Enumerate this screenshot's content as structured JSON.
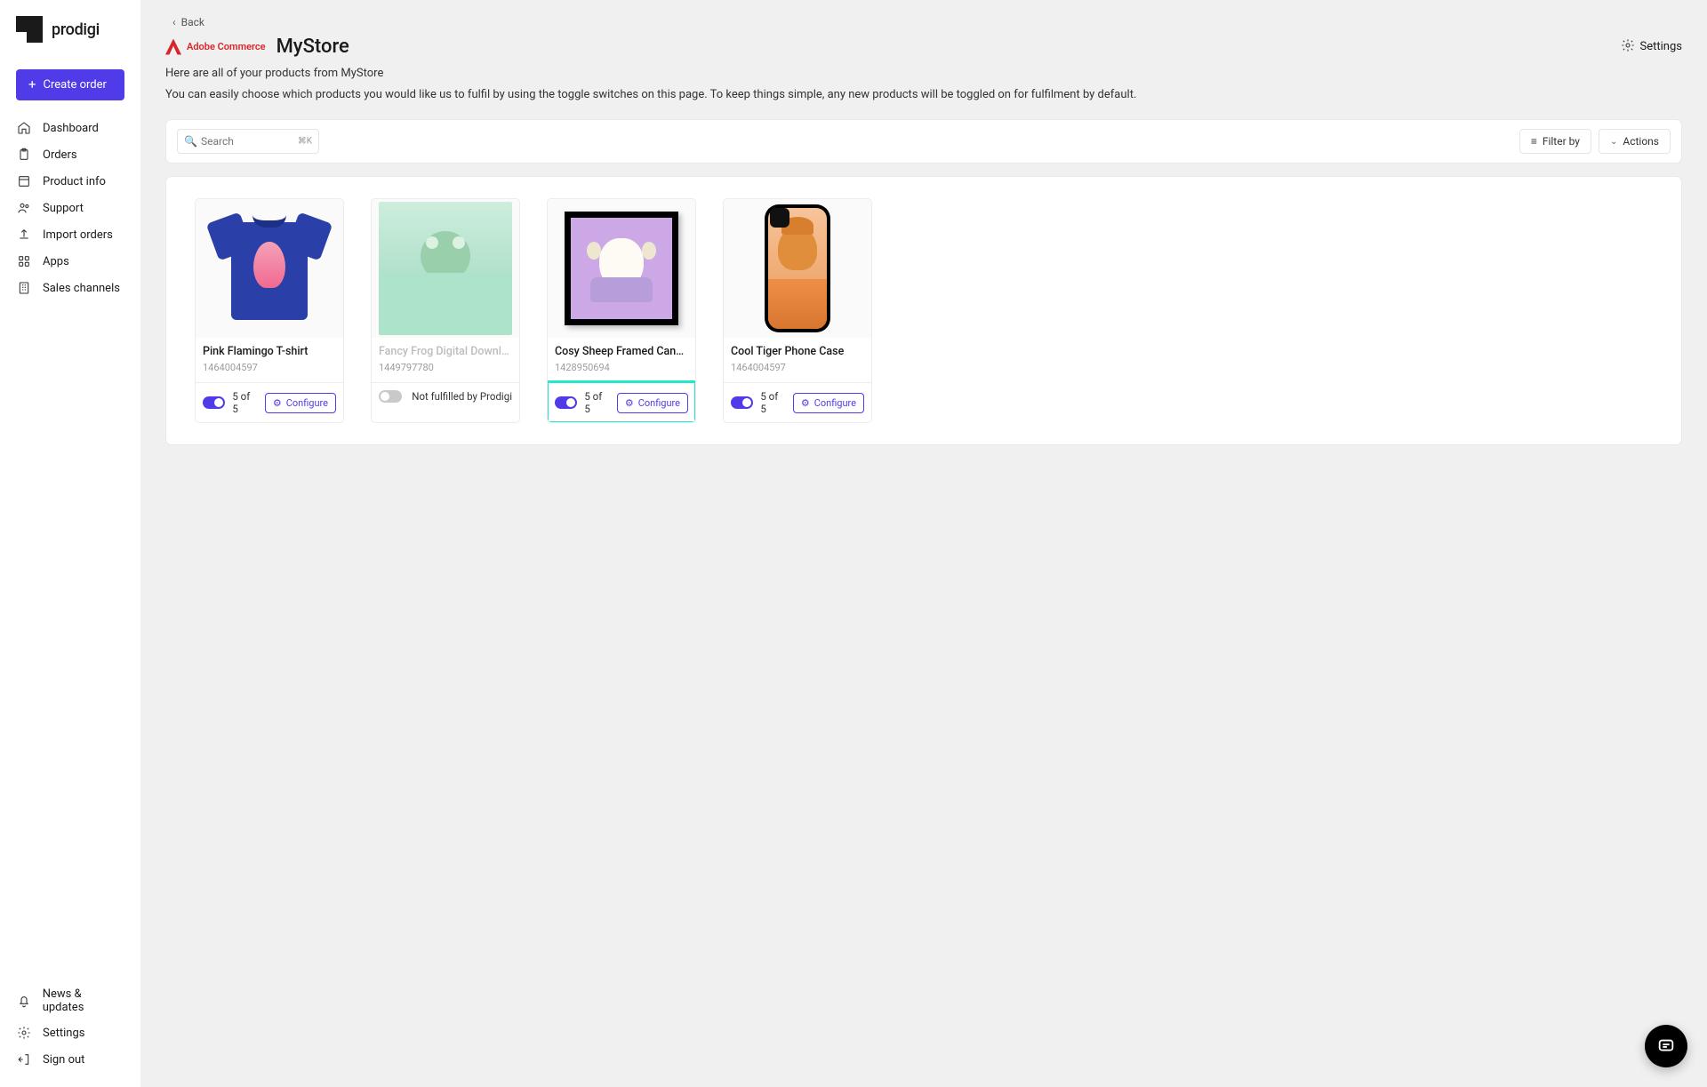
{
  "brand": {
    "name": "prodigi"
  },
  "sidebar": {
    "create_label": "Create order",
    "items": [
      "Dashboard",
      "Orders",
      "Product info",
      "Support",
      "Import orders",
      "Apps",
      "Sales channels"
    ],
    "bottom": [
      "News & updates",
      "Settings",
      "Sign out"
    ]
  },
  "page": {
    "back_label": "Back",
    "integration_name": "Adobe Commerce",
    "store_name": "MyStore",
    "settings_label": "Settings",
    "desc_prefix": "Here are all of your products from ",
    "desc_store": "MyStore",
    "desc2": "You can easily choose which products you would like us to fulfil by using the toggle switches on this page. To keep things simple, any new products will be toggled on for fulfilment by default."
  },
  "toolbar": {
    "search_placeholder": "Search",
    "search_shortcut": "⌘K",
    "filter_label": "Filter by",
    "actions_label": "Actions"
  },
  "products": [
    {
      "title": "Pink Flamingo T-shirt",
      "sku": "1464004597",
      "enabled": true,
      "count": "5 of 5",
      "configure_label": "Configure",
      "highlight": false
    },
    {
      "title": "Fancy Frog Digital Download",
      "sku": "1449797780",
      "enabled": false,
      "not_fulfilled_label": "Not fulfilled by Prodigi",
      "highlight": false
    },
    {
      "title": "Cosy Sheep Framed Canvas",
      "sku": "1428950694",
      "enabled": true,
      "count": "5 of 5",
      "configure_label": "Configure",
      "highlight": true
    },
    {
      "title": "Cool Tiger Phone Case",
      "sku": "1464004597",
      "enabled": true,
      "count": "5 of 5",
      "configure_label": "Configure",
      "highlight": false
    }
  ]
}
